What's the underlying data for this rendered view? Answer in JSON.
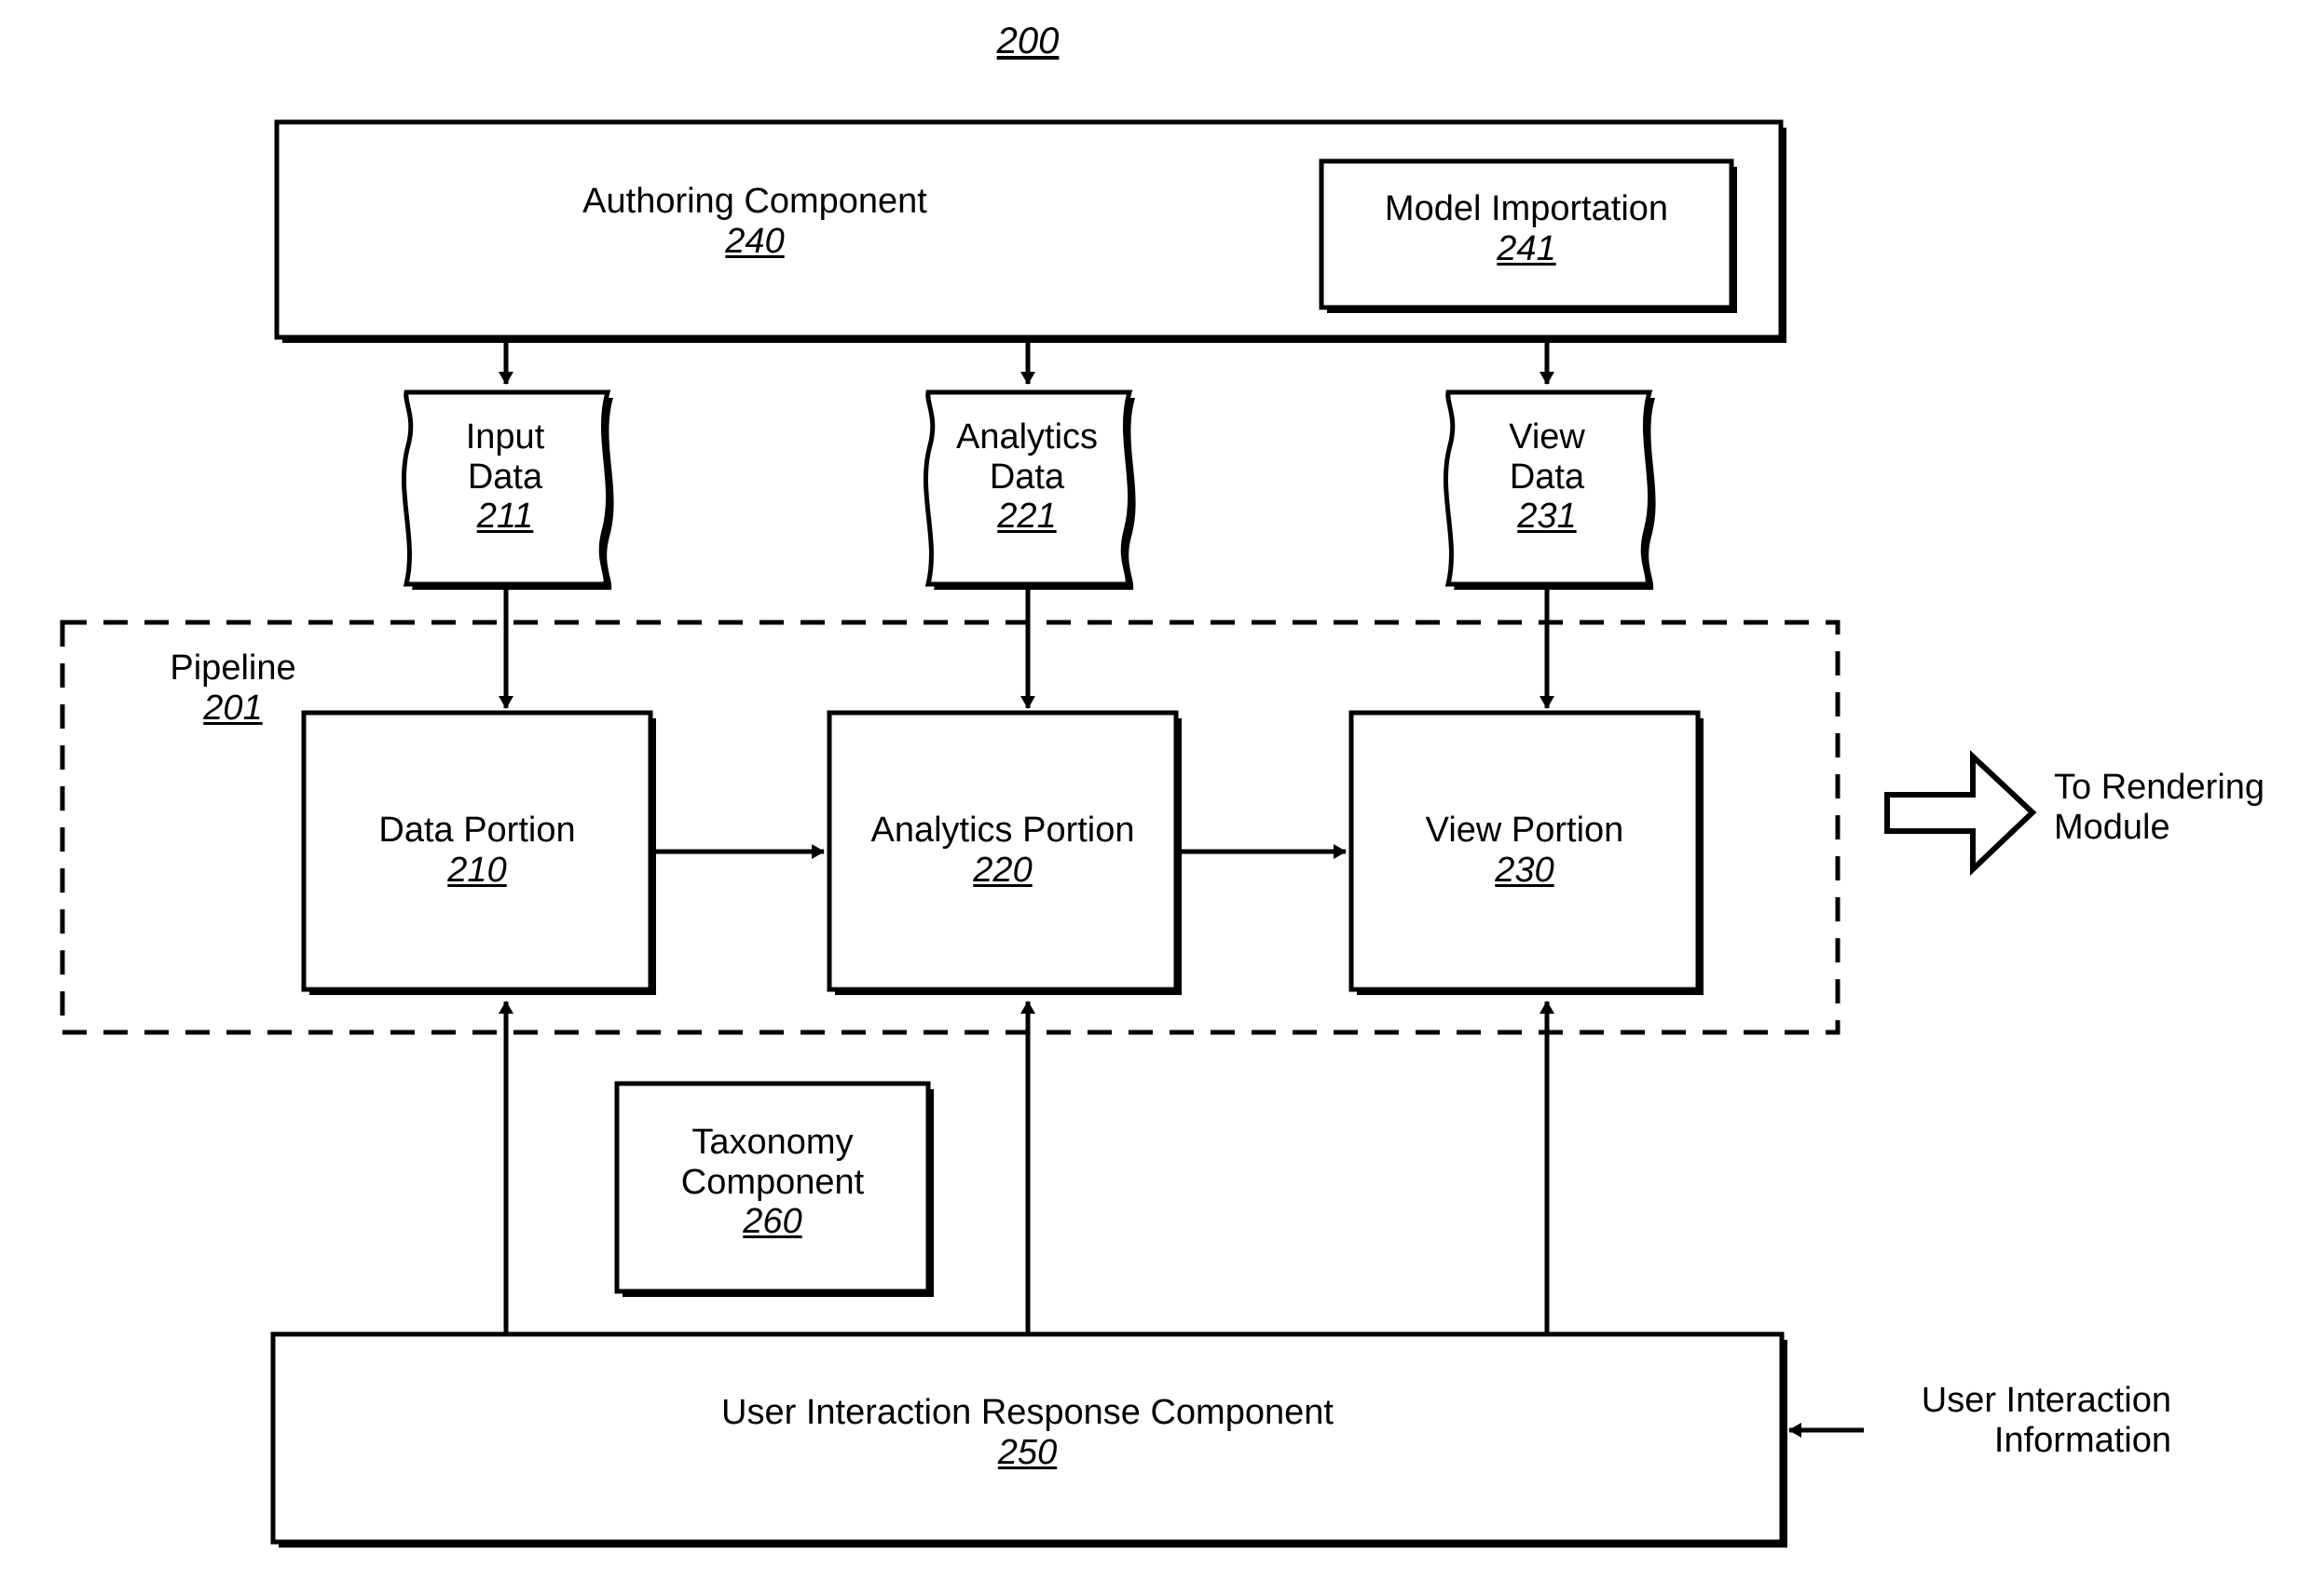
{
  "figure": {
    "number": "200"
  },
  "authoring": {
    "title": "Authoring Component",
    "ref": "240"
  },
  "model_importation": {
    "title": "Model Importation",
    "ref": "241"
  },
  "datastores": [
    {
      "line1": "Input",
      "line2": "Data",
      "ref": "211",
      "name": "input-data-store"
    },
    {
      "line1": "Analytics",
      "line2": "Data",
      "ref": "221",
      "name": "analytics-data-store"
    },
    {
      "line1": "View",
      "line2": "Data",
      "ref": "231",
      "name": "view-data-store"
    }
  ],
  "pipeline": {
    "label": "Pipeline",
    "ref": "201",
    "portions": [
      {
        "title": "Data Portion",
        "ref": "210"
      },
      {
        "title": "Analytics Portion",
        "ref": "220"
      },
      {
        "title": "View Portion",
        "ref": "230"
      }
    ]
  },
  "rendering": {
    "line1": "To Rendering",
    "line2": "Module"
  },
  "taxonomy": {
    "line1": "Taxonomy",
    "line2": "Component",
    "ref": "260"
  },
  "user_interaction_response": {
    "title": "User Interaction Response Component",
    "ref": "250"
  },
  "user_interaction_information": {
    "line1": "User Interaction",
    "line2": "Information"
  },
  "colors": {
    "stroke": "#000000",
    "fill": "#ffffff"
  }
}
